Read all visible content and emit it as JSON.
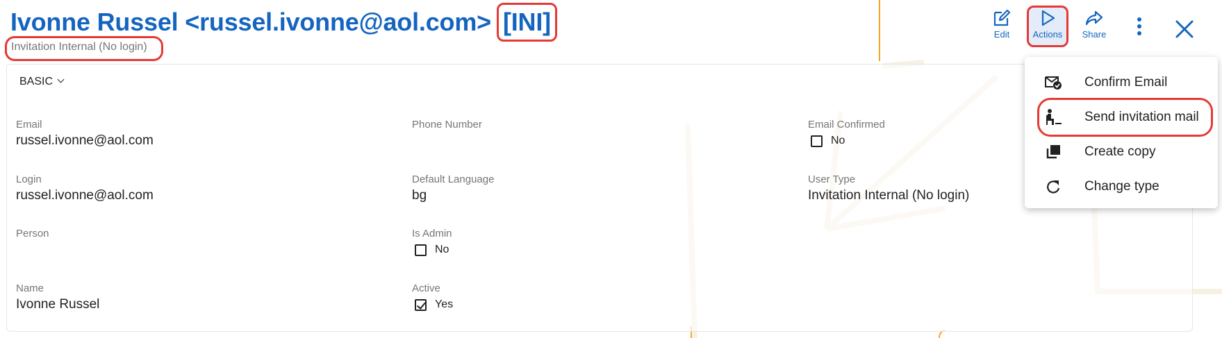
{
  "header": {
    "title": "Ivonne Russel <russel.ivonne@aol.com>",
    "code": "[INI]",
    "subtitle": "Invitation Internal (No login)"
  },
  "toolbar": {
    "edit_label": "Edit",
    "actions_label": "Actions",
    "share_label": "Share"
  },
  "section": {
    "label": "BASIC"
  },
  "fields": {
    "email": {
      "label": "Email",
      "value": "russel.ivonne@aol.com"
    },
    "phone": {
      "label": "Phone Number",
      "value": ""
    },
    "email_confirmed": {
      "label": "Email Confirmed",
      "value": "No",
      "checked": false
    },
    "login": {
      "label": "Login",
      "value": "russel.ivonne@aol.com"
    },
    "default_language": {
      "label": "Default Language",
      "value": "bg"
    },
    "user_type": {
      "label": "User Type",
      "value": "Invitation Internal (No login)"
    },
    "person": {
      "label": "Person",
      "value": ""
    },
    "is_admin": {
      "label": "Is Admin",
      "value": "No",
      "checked": false
    },
    "name": {
      "label": "Name",
      "value": "Ivonne Russel"
    },
    "active": {
      "label": "Active",
      "value": "Yes",
      "checked": true
    }
  },
  "menu": {
    "items": [
      {
        "label": "Confirm Email",
        "icon": "email-check-icon"
      },
      {
        "label": "Send invitation mail",
        "icon": "send-invitation-icon"
      },
      {
        "label": "Create copy",
        "icon": "copy-icon"
      },
      {
        "label": "Change type",
        "icon": "refresh-icon"
      }
    ]
  },
  "colors": {
    "primary": "#1565c0",
    "highlight": "#e53935",
    "decor": "#f5a623"
  }
}
